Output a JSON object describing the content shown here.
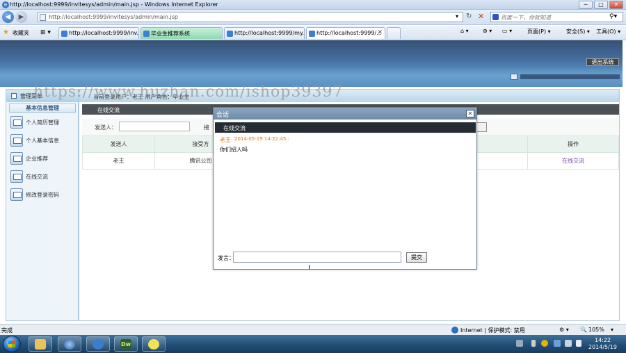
{
  "browser": {
    "window_title": "http://localhost:9999/invitesys/admin/main.jsp - Windows Internet Explorer",
    "url": "http://localhost:9999/invitesys/admin/main.jsp",
    "search_placeholder": "百度一下，你就知道",
    "favorites_label": "收藏夹",
    "tabs": [
      {
        "label": "http://localhost:9999/inv..."
      },
      {
        "label": "毕业生推荐系统"
      },
      {
        "label": "http://localhost:9999/my..."
      },
      {
        "label": "http://localhost:9999/..."
      }
    ],
    "commands": {
      "page": "页面(P) ▾",
      "safety": "安全(S) ▾",
      "tools": "工具(O) ▾"
    }
  },
  "app": {
    "logout_label": "退出系统",
    "watermark": "https://www.huzhan.com/ishop39397",
    "menu": {
      "header": "管理菜单",
      "section": "基本信息管理",
      "items": [
        {
          "label": "个人简历管理"
        },
        {
          "label": "个人基本信息"
        },
        {
          "label": "企业推荐"
        },
        {
          "label": "在线交流"
        },
        {
          "label": "修改登录密码"
        }
      ]
    },
    "main": {
      "login_info": "当前登录用户：老王  用户角色：毕业生",
      "section_title": "在线交流",
      "filter": {
        "sender_label": "发送人：",
        "receiver_label": "接"
      },
      "table": {
        "headers": [
          "发送人",
          "接受方",
          "",
          "操作"
        ],
        "rows": [
          {
            "sender": "老王",
            "receiver": "腾讯公司",
            "content": "",
            "action": "在线交流"
          }
        ]
      }
    },
    "dialog": {
      "title": "会话",
      "close": "✕",
      "subtitle": "在线交流",
      "messages": [
        {
          "user": "老王",
          "time": "2014-05-19 14:22:45 :",
          "text": "你们招人吗"
        }
      ],
      "input_label": "发言：",
      "submit_label": "提交"
    }
  },
  "statusbar": {
    "left": "完成",
    "zone": "Internet | 保护模式: 禁用",
    "zoom": "105%"
  },
  "taskbar": {
    "time": "14:22",
    "date": "2014/5/19"
  }
}
